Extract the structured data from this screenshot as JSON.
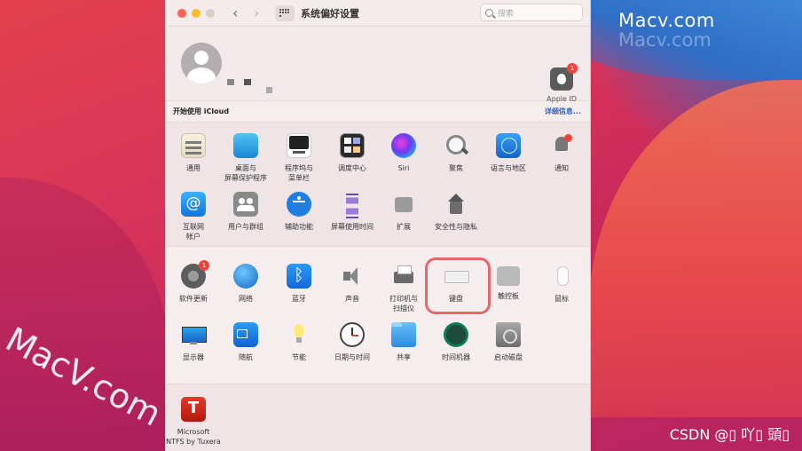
{
  "window": {
    "title": "系统偏好设置",
    "search_placeholder": "搜索"
  },
  "account": {
    "apple_id_label": "Apple ID",
    "apple_id_badge": "1"
  },
  "icloud_bar": {
    "left": "开始使用 iCloud",
    "right": "详细信息..."
  },
  "section1": [
    {
      "name": "general",
      "label": "通用"
    },
    {
      "name": "desktop",
      "label": "桌面与\n屏幕保护程序"
    },
    {
      "name": "dock",
      "label": "程序坞与\n菜单栏"
    },
    {
      "name": "mission",
      "label": "调度中心"
    },
    {
      "name": "siri",
      "label": "Siri"
    },
    {
      "name": "spotlight",
      "label": "聚焦"
    },
    {
      "name": "language",
      "label": "语言与地区"
    },
    {
      "name": "notify",
      "label": "通知"
    },
    {
      "name": "internet",
      "label": "互联网\n帐户"
    },
    {
      "name": "users",
      "label": "用户与群组"
    },
    {
      "name": "access",
      "label": "辅助功能"
    },
    {
      "name": "screentime",
      "label": "屏幕使用时间"
    },
    {
      "name": "ext",
      "label": "扩展"
    },
    {
      "name": "security",
      "label": "安全性与隐私"
    }
  ],
  "section2": [
    {
      "name": "update",
      "label": "软件更新",
      "badge": "1"
    },
    {
      "name": "network",
      "label": "网络"
    },
    {
      "name": "bluetooth",
      "label": "蓝牙"
    },
    {
      "name": "sound",
      "label": "声音"
    },
    {
      "name": "printer",
      "label": "打印机与\n扫描仪"
    },
    {
      "name": "keyboard",
      "label": "键盘"
    },
    {
      "name": "trackpad",
      "label": "触控板"
    },
    {
      "name": "mouse",
      "label": "鼠标"
    },
    {
      "name": "display",
      "label": "显示器"
    },
    {
      "name": "sidecar",
      "label": "随航"
    },
    {
      "name": "energy",
      "label": "节能"
    },
    {
      "name": "datetime",
      "label": "日期与时间"
    },
    {
      "name": "sharing",
      "label": "共享"
    },
    {
      "name": "timemachine",
      "label": "时间机器"
    },
    {
      "name": "startup",
      "label": "启动磁盘"
    }
  ],
  "section3": [
    {
      "name": "tuxera",
      "label": "Microsoft\nNTFS by Tuxera"
    }
  ],
  "watermarks": {
    "top": "Macv.com",
    "side": "MacV.com",
    "csdn": "CSDN @▯ 吖▯ 頭▯"
  }
}
